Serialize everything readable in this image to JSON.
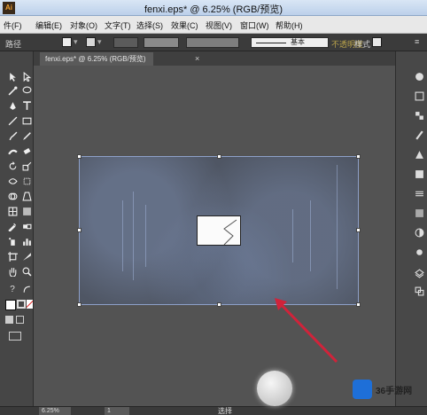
{
  "window": {
    "title": "fenxi.eps* @ 6.25% (RGB/预览)",
    "app_icon": "Ai"
  },
  "menubar": {
    "items": [
      "件(F)",
      "编辑(E)",
      "对象(O)",
      "文字(T)",
      "选择(S)",
      "效果(C)",
      "视图(V)",
      "窗口(W)",
      "帮助(H)"
    ]
  },
  "controlbar": {
    "group_label": "路径",
    "stroke_label": "基本",
    "opacity_label": "不透明度",
    "style_label": "样式"
  },
  "document_tab": {
    "label": "fenxi.eps* @ 6.25% (RGB/预览)",
    "close": "×"
  },
  "status": {
    "zoom": "6.25%",
    "page": "1",
    "tool": "选择"
  },
  "watermark": {
    "text": "36手游网"
  },
  "colors": {
    "canvas": "#535353",
    "panel": "#464646",
    "selection": "#8da0c8",
    "arrow": "#d0233a"
  },
  "icons": {
    "tools": [
      "selection-icon",
      "direct-selection-icon",
      "magic-wand-icon",
      "lasso-icon",
      "pen-icon",
      "type-icon",
      "line-icon",
      "rectangle-icon",
      "paintbrush-icon",
      "pencil-icon",
      "blob-brush-icon",
      "eraser-icon",
      "rotate-icon",
      "scale-icon",
      "width-icon",
      "free-transform-icon",
      "shape-builder-icon",
      "perspective-icon",
      "mesh-icon",
      "gradient-icon",
      "eyedropper-icon",
      "blend-icon",
      "symbol-sprayer-icon",
      "column-graph-icon",
      "artboard-icon",
      "slice-icon",
      "hand-icon",
      "zoom-icon",
      "help-icon",
      "swap-icon"
    ],
    "panels": [
      "color-icon",
      "color-guide-icon",
      "swatches-icon",
      "brushes-icon",
      "symbols-icon",
      "graphic-styles-icon",
      "stroke-icon",
      "gradient-panel-icon",
      "transparency-icon",
      "appearance-icon",
      "layers-icon",
      "artboards-panel-icon"
    ]
  }
}
